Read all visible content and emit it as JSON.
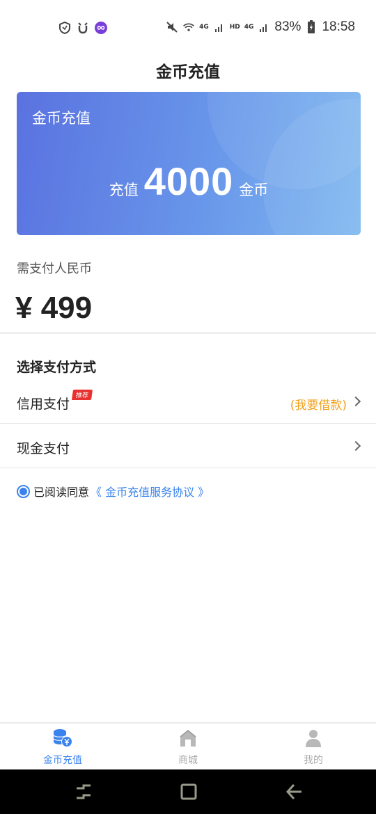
{
  "status_bar": {
    "battery": "83%",
    "time": "18:58",
    "net_hd": "HD",
    "net_4g_1": "4G",
    "net_4g_2": "4G",
    "icons": [
      "shield-icon",
      "alarm-icon",
      "infinity-icon",
      "mute-icon",
      "wifi-icon",
      "signal-icon",
      "battery-icon"
    ]
  },
  "header": {
    "title": "金币充值"
  },
  "card": {
    "label": "金币充值",
    "prefix": "充值",
    "amount": "4000",
    "suffix": "金币"
  },
  "payment": {
    "label": "需支付人民币",
    "price": "¥ 499"
  },
  "methods": {
    "title": "选择支付方式",
    "credit": {
      "label": "信用支付",
      "badge": "推荐",
      "extra": "(我要借款)"
    },
    "cash": {
      "label": "现金支付"
    }
  },
  "agreement": {
    "text": "已阅读同意",
    "link": "《 金币充值服务协议 》",
    "checked": true
  },
  "tabs": [
    {
      "label": "金币充值",
      "icon": "coins-icon",
      "active": true
    },
    {
      "label": "商城",
      "icon": "store-icon",
      "active": false
    },
    {
      "label": "我的",
      "icon": "user-icon",
      "active": false
    }
  ],
  "colors": {
    "accent": "#3a83ee",
    "card_start": "#5a72e0",
    "card_end": "#80b9ef",
    "badge": "#e9312f",
    "loan_text": "#f0a019"
  }
}
